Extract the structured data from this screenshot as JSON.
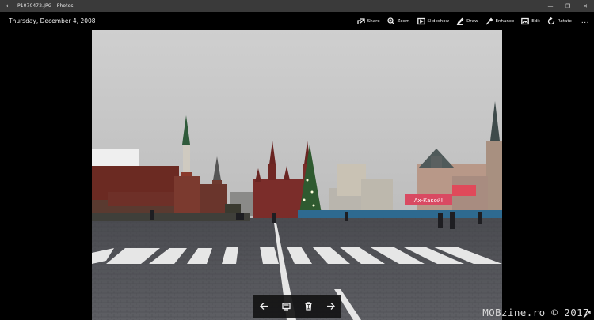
{
  "window": {
    "title": "P1070472.JPG - Photos",
    "back_icon": "back-arrow-icon",
    "controls": [
      "minimize-icon",
      "restore-icon",
      "close-icon"
    ]
  },
  "header": {
    "date": "Thursday, December 4, 2008"
  },
  "toolbar": {
    "share_label": "Share",
    "zoom_label": "Zoom",
    "slideshow_label": "Slideshow",
    "draw_label": "Draw",
    "enhance_label": "Enhance",
    "edit_label": "Edit",
    "rotate_label": "Rotate",
    "more_label": "..."
  },
  "photo": {
    "sign_text": "Ах-Какой!"
  },
  "navigation": {
    "items": [
      "previous-arrow-icon",
      "slideshow-icon",
      "delete-icon",
      "next-arrow-icon"
    ]
  },
  "watermark": {
    "text": "MOBzine.ro © 2017"
  },
  "colors": {
    "titlebar_bg": "#3a3a3a",
    "background": "#000000",
    "sky": "#c9c9c9",
    "kremlin_wall": "#6d2a22",
    "museum_red": "#7b2d2a",
    "pavement": "#57585c"
  }
}
